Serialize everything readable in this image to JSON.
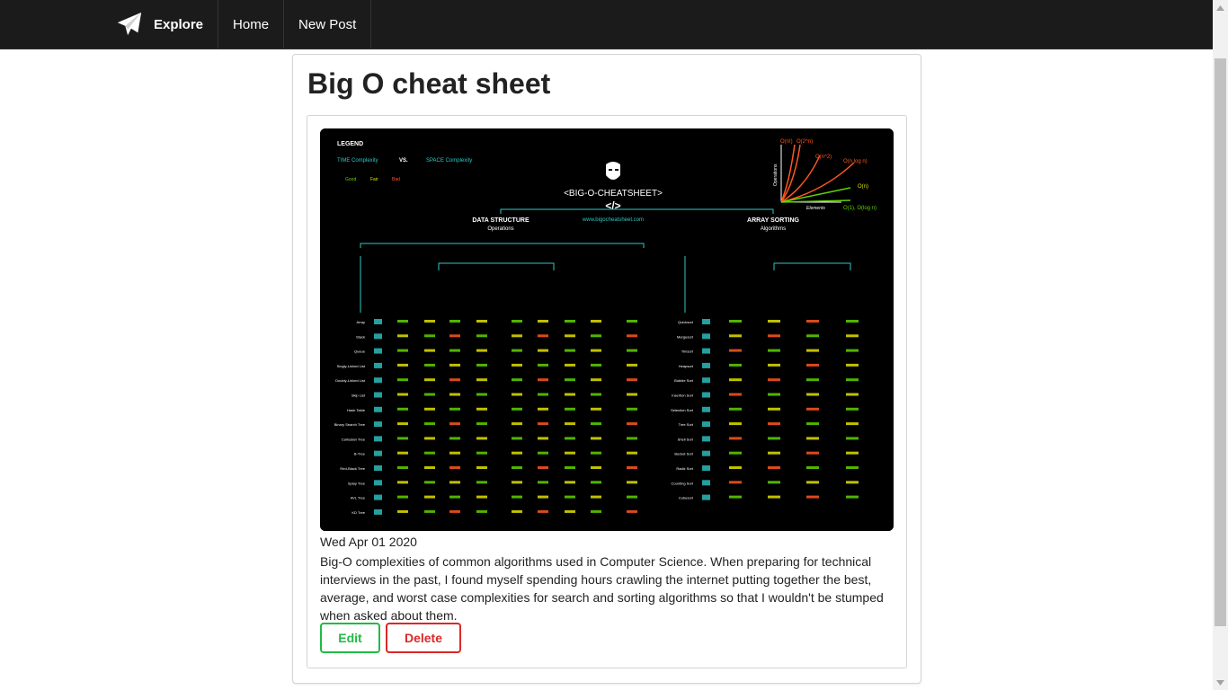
{
  "nav": {
    "brand": "Explore",
    "items": [
      "Home",
      "New Post"
    ]
  },
  "post": {
    "title": "Big O cheat sheet",
    "date": "Wed Apr 01 2020",
    "body": "Big-O complexities of common algorithms used in Computer Science. When preparing for technical interviews in the past, I found myself spending hours crawling the internet putting together the best, average, and worst case complexities for search and sorting algorithms so that I wouldn't be stumped when asked about them.",
    "edit_label": "Edit",
    "delete_label": "Delete"
  },
  "cheatsheet": {
    "legend_title": "LEGEND",
    "time_label": "TIME Complexity",
    "vs": "VS.",
    "space_label": "SPACE Complexity",
    "ratings": [
      "Good",
      "Fair",
      "Bad"
    ],
    "title": "<BIG-O-CHEATSHEET>",
    "url": "www.bigocheatsheet.com",
    "ds_title": "DATA STRUCTURE",
    "ds_sub": "Operations",
    "sort_title": "ARRAY SORTING",
    "sort_sub": "Algorithms",
    "graph_labels": [
      "O(n!)",
      "O(2^n)",
      "O(n^2)",
      "O(n log n)",
      "O(n)",
      "O(1), O(log n)"
    ],
    "graph_axis_y": "Operations",
    "graph_axis_x": "Elements",
    "ds_rows": [
      "Array",
      "Stack",
      "Queue",
      "Singly-Linked List",
      "Doubly-Linked List",
      "Skip List",
      "Hash Table",
      "Binary Search Tree",
      "Cartesian Tree",
      "B-Tree",
      "Red-Black Tree",
      "Splay Tree",
      "AVL Tree",
      "KD Tree"
    ],
    "sort_rows": [
      "Quicksort",
      "Mergesort",
      "Timsort",
      "Heapsort",
      "Bubble Sort",
      "Insertion Sort",
      "Selection Sort",
      "Tree Sort",
      "Shell Sort",
      "Bucket Sort",
      "Radix Sort",
      "Counting Sort",
      "Cubesort"
    ]
  },
  "colors": {
    "navbar": "#1b1b1b",
    "edit": "#21ba45",
    "delete": "#db2828",
    "sheet_good": "#5fd400",
    "sheet_fair": "#e2e200",
    "sheet_bad": "#ff5722",
    "sheet_accent": "#2fc7c7"
  },
  "icons": {
    "brand": "paper-plane-icon"
  }
}
